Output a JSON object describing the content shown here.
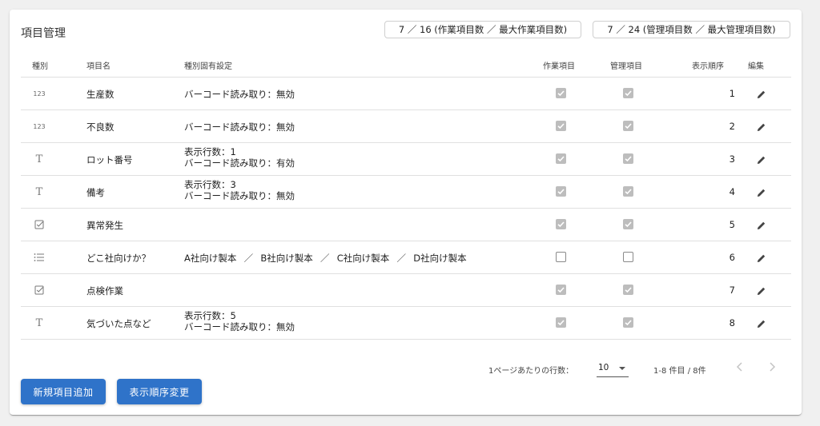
{
  "header": {
    "title": "項目管理",
    "work_counter": "7 ／ 16 (作業項目数 ／ 最大作業項目数)",
    "mgmt_counter": "7 ／ 24 (管理項目数 ／ 最大管理項目数)"
  },
  "table": {
    "headers": {
      "type": "種別",
      "name": "項目名",
      "spec": "種別固有設定",
      "work": "作業項目",
      "mgmt": "管理項目",
      "order": "表示順序",
      "edit": "編集"
    },
    "rows": [
      {
        "type_icon": "number-icon",
        "type_glyph": "123",
        "name": "生産数",
        "spec": [
          "バーコード読み取り：無効"
        ],
        "work": true,
        "mgmt": true,
        "order": "1"
      },
      {
        "type_icon": "number-icon",
        "type_glyph": "123",
        "name": "不良数",
        "spec": [
          "バーコード読み取り：無効"
        ],
        "work": true,
        "mgmt": true,
        "order": "2"
      },
      {
        "type_icon": "text-icon",
        "type_glyph": "T",
        "name": "ロット番号",
        "spec": [
          "表示行数：1",
          "バーコード読み取り：有効"
        ],
        "work": true,
        "mgmt": true,
        "order": "3"
      },
      {
        "type_icon": "text-icon",
        "type_glyph": "T",
        "name": "備考",
        "spec": [
          "表示行数：3",
          "バーコード読み取り：無効"
        ],
        "work": true,
        "mgmt": true,
        "order": "4"
      },
      {
        "type_icon": "checkbox-icon",
        "type_glyph": "",
        "name": "異常発生",
        "spec": [],
        "work": true,
        "mgmt": true,
        "order": "5"
      },
      {
        "type_icon": "list-icon",
        "type_glyph": "",
        "name": "どこ社向けか？",
        "options": [
          "A社向け製本",
          "B社向け製本",
          "C社向け製本",
          "D社向け製本"
        ],
        "options_sep": "／",
        "spec": [],
        "work": false,
        "mgmt": false,
        "order": "6"
      },
      {
        "type_icon": "checkbox-icon",
        "type_glyph": "",
        "name": "点検作業",
        "spec": [],
        "work": true,
        "mgmt": true,
        "order": "7"
      },
      {
        "type_icon": "text-icon",
        "type_glyph": "T",
        "name": "気づいた点など",
        "spec": [
          "表示行数：5",
          "バーコード読み取り：無効"
        ],
        "work": true,
        "mgmt": true,
        "order": "8"
      }
    ]
  },
  "pagination": {
    "rows_per_page_label": "1ページあたりの行数：",
    "rows_per_page": "10",
    "range": "1-8 件目 / 8件"
  },
  "buttons": {
    "add": "新規項目追加",
    "reorder": "表示順序変更"
  },
  "colors": {
    "primary": "#2f73c9",
    "checkbox_checked": "#bdbdbd",
    "divider": "#e0e0e0"
  }
}
